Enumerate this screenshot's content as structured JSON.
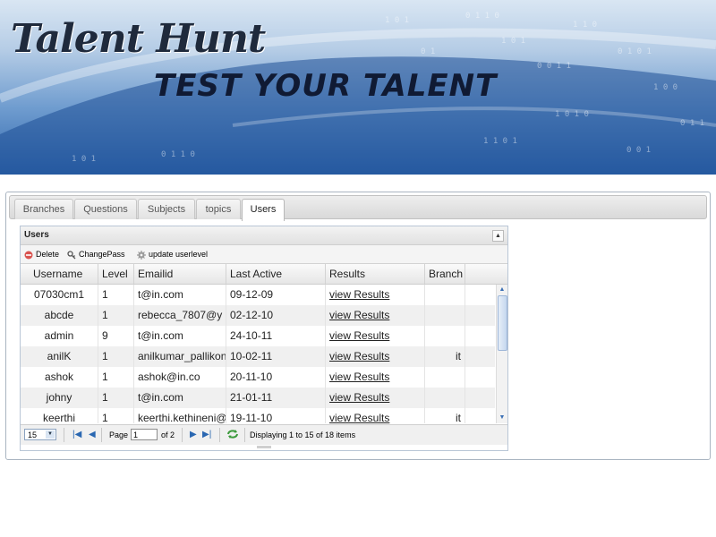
{
  "banner": {
    "title": "Talent Hunt",
    "tagline": "TEST YOUR TALENT"
  },
  "tabs": [
    {
      "label": "Branches",
      "active": false
    },
    {
      "label": "Questions",
      "active": false
    },
    {
      "label": "Subjects",
      "active": false
    },
    {
      "label": "topics",
      "active": false
    },
    {
      "label": "Users",
      "active": true
    }
  ],
  "grid": {
    "title": "Users",
    "toolbar": {
      "delete_label": "Delete",
      "changepass_label": "ChangePass",
      "update_label": "update userlevel"
    },
    "columns": [
      "Username",
      "Level",
      "Emailid",
      "Last Active",
      "Results",
      "Branch"
    ],
    "rows": [
      {
        "username": "07030cm1",
        "level": "1",
        "email": "t@in.com",
        "last_active": "09-12-09",
        "results": "view Results",
        "branch": ""
      },
      {
        "username": "abcde",
        "level": "1",
        "email": "rebecca_7807@y",
        "last_active": "02-12-10",
        "results": "view Results",
        "branch": ""
      },
      {
        "username": "admin",
        "level": "9",
        "email": "t@in.com",
        "last_active": "24-10-11",
        "results": "view Results",
        "branch": ""
      },
      {
        "username": "anilK",
        "level": "1",
        "email": "anilkumar_pallikon",
        "last_active": "10-02-11",
        "results": "view Results",
        "branch": "it"
      },
      {
        "username": "ashok",
        "level": "1",
        "email": "ashok@in.co",
        "last_active": "20-11-10",
        "results": "view Results",
        "branch": ""
      },
      {
        "username": "johny",
        "level": "1",
        "email": "t@in.com",
        "last_active": "21-01-11",
        "results": "view Results",
        "branch": ""
      },
      {
        "username": "keerthi",
        "level": "1",
        "email": "keerthi.kethineni@",
        "last_active": "19-11-10",
        "results": "view Results",
        "branch": "it"
      }
    ],
    "pager": {
      "page_size": "15",
      "page_label": "Page",
      "page_value": "1",
      "of_label": "of 2",
      "display_text": "Displaying 1 to 15 of 18 items"
    }
  },
  "colors": {
    "accent": "#2a67b1",
    "banner_dark": "#1f2a3c"
  }
}
